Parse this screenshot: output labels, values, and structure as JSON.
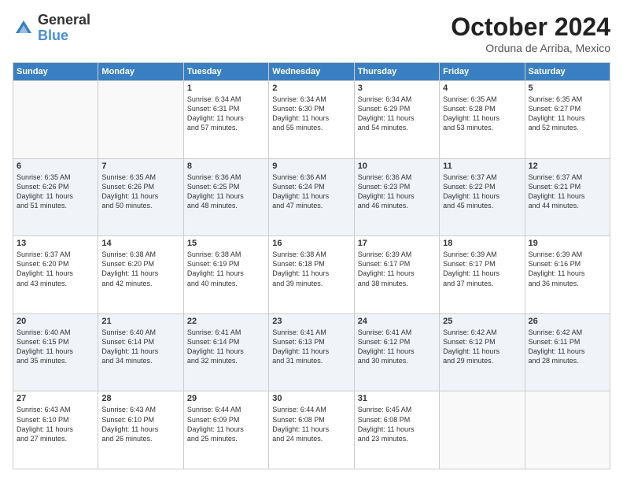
{
  "logo": {
    "general": "General",
    "blue": "Blue"
  },
  "title": "October 2024",
  "location": "Orduna de Arriba, Mexico",
  "days": [
    "Sunday",
    "Monday",
    "Tuesday",
    "Wednesday",
    "Thursday",
    "Friday",
    "Saturday"
  ],
  "weeks": [
    [
      {
        "day": "",
        "content": ""
      },
      {
        "day": "",
        "content": ""
      },
      {
        "day": "1",
        "content": "Sunrise: 6:34 AM\nSunset: 6:31 PM\nDaylight: 11 hours\nand 57 minutes."
      },
      {
        "day": "2",
        "content": "Sunrise: 6:34 AM\nSunset: 6:30 PM\nDaylight: 11 hours\nand 55 minutes."
      },
      {
        "day": "3",
        "content": "Sunrise: 6:34 AM\nSunset: 6:29 PM\nDaylight: 11 hours\nand 54 minutes."
      },
      {
        "day": "4",
        "content": "Sunrise: 6:35 AM\nSunset: 6:28 PM\nDaylight: 11 hours\nand 53 minutes."
      },
      {
        "day": "5",
        "content": "Sunrise: 6:35 AM\nSunset: 6:27 PM\nDaylight: 11 hours\nand 52 minutes."
      }
    ],
    [
      {
        "day": "6",
        "content": "Sunrise: 6:35 AM\nSunset: 6:26 PM\nDaylight: 11 hours\nand 51 minutes."
      },
      {
        "day": "7",
        "content": "Sunrise: 6:35 AM\nSunset: 6:26 PM\nDaylight: 11 hours\nand 50 minutes."
      },
      {
        "day": "8",
        "content": "Sunrise: 6:36 AM\nSunset: 6:25 PM\nDaylight: 11 hours\nand 48 minutes."
      },
      {
        "day": "9",
        "content": "Sunrise: 6:36 AM\nSunset: 6:24 PM\nDaylight: 11 hours\nand 47 minutes."
      },
      {
        "day": "10",
        "content": "Sunrise: 6:36 AM\nSunset: 6:23 PM\nDaylight: 11 hours\nand 46 minutes."
      },
      {
        "day": "11",
        "content": "Sunrise: 6:37 AM\nSunset: 6:22 PM\nDaylight: 11 hours\nand 45 minutes."
      },
      {
        "day": "12",
        "content": "Sunrise: 6:37 AM\nSunset: 6:21 PM\nDaylight: 11 hours\nand 44 minutes."
      }
    ],
    [
      {
        "day": "13",
        "content": "Sunrise: 6:37 AM\nSunset: 6:20 PM\nDaylight: 11 hours\nand 43 minutes."
      },
      {
        "day": "14",
        "content": "Sunrise: 6:38 AM\nSunset: 6:20 PM\nDaylight: 11 hours\nand 42 minutes."
      },
      {
        "day": "15",
        "content": "Sunrise: 6:38 AM\nSunset: 6:19 PM\nDaylight: 11 hours\nand 40 minutes."
      },
      {
        "day": "16",
        "content": "Sunrise: 6:38 AM\nSunset: 6:18 PM\nDaylight: 11 hours\nand 39 minutes."
      },
      {
        "day": "17",
        "content": "Sunrise: 6:39 AM\nSunset: 6:17 PM\nDaylight: 11 hours\nand 38 minutes."
      },
      {
        "day": "18",
        "content": "Sunrise: 6:39 AM\nSunset: 6:17 PM\nDaylight: 11 hours\nand 37 minutes."
      },
      {
        "day": "19",
        "content": "Sunrise: 6:39 AM\nSunset: 6:16 PM\nDaylight: 11 hours\nand 36 minutes."
      }
    ],
    [
      {
        "day": "20",
        "content": "Sunrise: 6:40 AM\nSunset: 6:15 PM\nDaylight: 11 hours\nand 35 minutes."
      },
      {
        "day": "21",
        "content": "Sunrise: 6:40 AM\nSunset: 6:14 PM\nDaylight: 11 hours\nand 34 minutes."
      },
      {
        "day": "22",
        "content": "Sunrise: 6:41 AM\nSunset: 6:14 PM\nDaylight: 11 hours\nand 32 minutes."
      },
      {
        "day": "23",
        "content": "Sunrise: 6:41 AM\nSunset: 6:13 PM\nDaylight: 11 hours\nand 31 minutes."
      },
      {
        "day": "24",
        "content": "Sunrise: 6:41 AM\nSunset: 6:12 PM\nDaylight: 11 hours\nand 30 minutes."
      },
      {
        "day": "25",
        "content": "Sunrise: 6:42 AM\nSunset: 6:12 PM\nDaylight: 11 hours\nand 29 minutes."
      },
      {
        "day": "26",
        "content": "Sunrise: 6:42 AM\nSunset: 6:11 PM\nDaylight: 11 hours\nand 28 minutes."
      }
    ],
    [
      {
        "day": "27",
        "content": "Sunrise: 6:43 AM\nSunset: 6:10 PM\nDaylight: 11 hours\nand 27 minutes."
      },
      {
        "day": "28",
        "content": "Sunrise: 6:43 AM\nSunset: 6:10 PM\nDaylight: 11 hours\nand 26 minutes."
      },
      {
        "day": "29",
        "content": "Sunrise: 6:44 AM\nSunset: 6:09 PM\nDaylight: 11 hours\nand 25 minutes."
      },
      {
        "day": "30",
        "content": "Sunrise: 6:44 AM\nSunset: 6:08 PM\nDaylight: 11 hours\nand 24 minutes."
      },
      {
        "day": "31",
        "content": "Sunrise: 6:45 AM\nSunset: 6:08 PM\nDaylight: 11 hours\nand 23 minutes."
      },
      {
        "day": "",
        "content": ""
      },
      {
        "day": "",
        "content": ""
      }
    ]
  ]
}
